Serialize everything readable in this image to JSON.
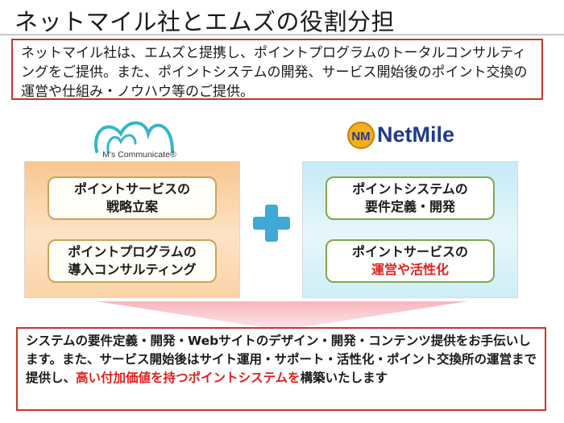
{
  "title": "ネットマイル社とエムズの役割分担",
  "intro": "ネットマイル社は、エムズと提携し、ポイントプログラムのトータルコンサルティングをご提供。また、ポイントシステムの開発、サービス開始後のポイント交換の運営や仕組み・ノウハウ等のご提供。",
  "left_logo": {
    "name": "M's Communicate",
    "caption": "M's Communicate®"
  },
  "right_logo": {
    "name": "NetMile",
    "mark": "NM"
  },
  "left_panel": {
    "card1": {
      "line1": "ポイントサービスの",
      "line2": "戦略立案"
    },
    "card2": {
      "line1": "ポイントプログラムの",
      "line2": "導入コンサルティング"
    }
  },
  "right_panel": {
    "card1": {
      "line1": "ポイントシステムの",
      "line2": "要件定義・開発"
    },
    "card2": {
      "line1": "ポイントサービスの",
      "line2": "運営や活性化"
    }
  },
  "summary": {
    "text1": "システムの要件定義・開発・Webサイトのデザイン・開発・コンテンツ提供をお手伝いします。また、サービス開始後はサイト運用・サポート・活性化・ポイント交換所の運営まで提供し、",
    "highlight": "高い付加価値を持つポイントシステムを",
    "text2": "構築いたします"
  },
  "colors": {
    "accent_red": "#e0201b",
    "frame_red": "#c0392b",
    "plus_blue": "#3fa8d6",
    "brand_navy": "#1f3a8a"
  },
  "icons": [
    "ms-communicate-logo-icon",
    "netmile-logo-icon",
    "plus-icon",
    "down-arrow-icon"
  ]
}
